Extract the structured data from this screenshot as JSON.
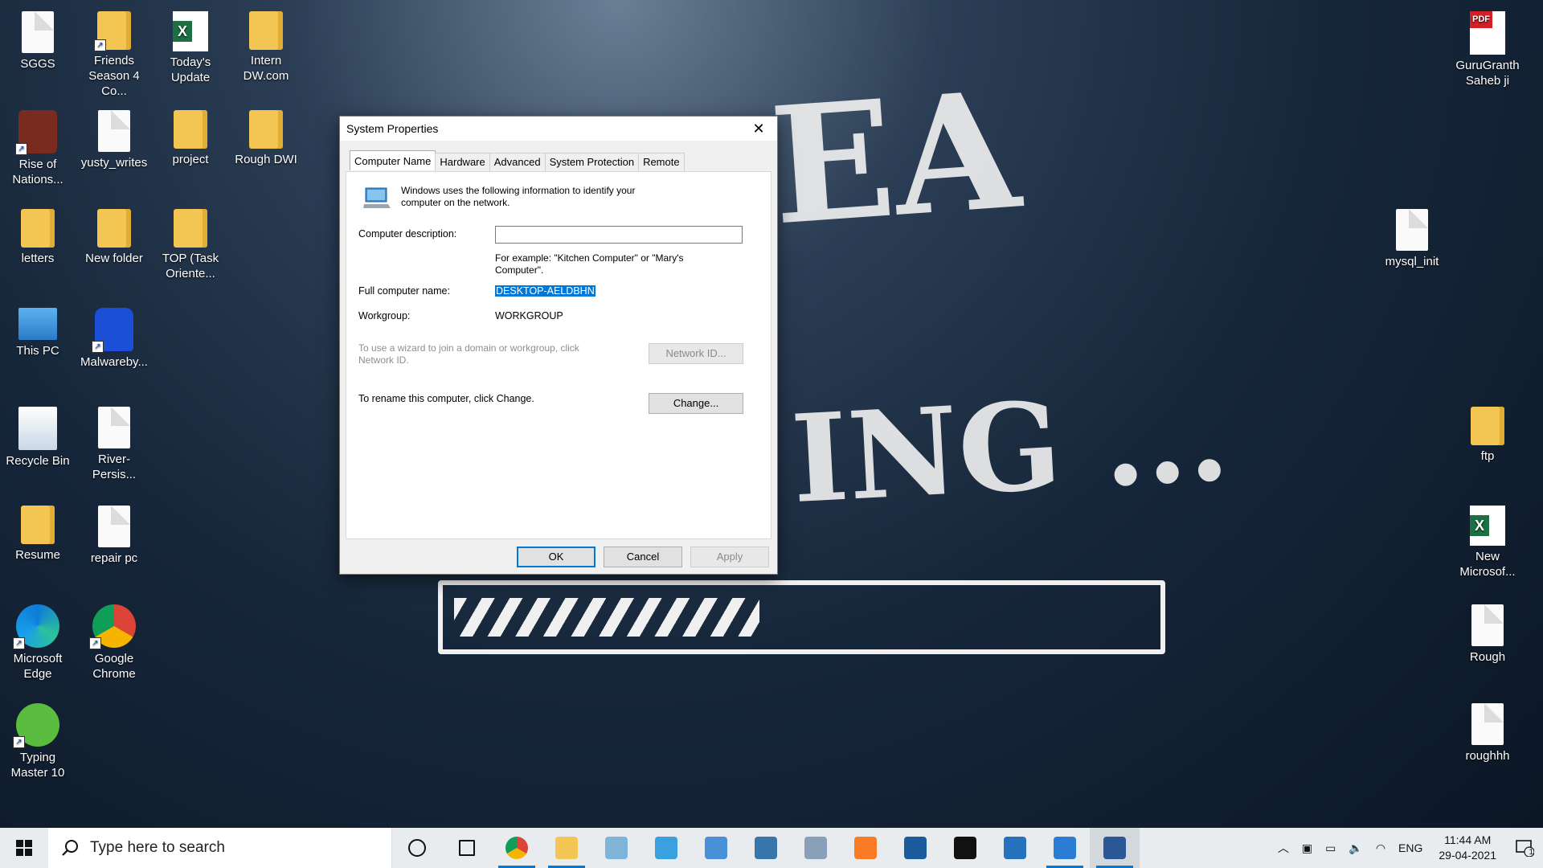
{
  "desktop": {
    "left_icons": [
      {
        "label": "SGGS",
        "type": "doc"
      },
      {
        "label": "Friends Season 4 Co...",
        "type": "folder",
        "shortcut": true
      },
      {
        "label": "Today's Update",
        "type": "excel"
      },
      {
        "label": "Intern DW.com",
        "type": "folder"
      },
      {
        "label": "Rise of Nations...",
        "type": "app-game",
        "shortcut": true
      },
      {
        "label": "yusty_writes",
        "type": "doc"
      },
      {
        "label": "project",
        "type": "folder"
      },
      {
        "label": "Rough DWI",
        "type": "folder"
      },
      {
        "label": "letters",
        "type": "folder"
      },
      {
        "label": "New folder",
        "type": "folder"
      },
      {
        "label": "TOP (Task Oriente...",
        "type": "folder"
      },
      {
        "label": "This PC",
        "type": "this-pc"
      },
      {
        "label": "Malwareby...",
        "type": "malwarebytes",
        "shortcut": true
      },
      {
        "label": "Recycle Bin",
        "type": "recycle-bin"
      },
      {
        "label": "River-Persis...",
        "type": "image"
      },
      {
        "label": "Resume",
        "type": "folder"
      },
      {
        "label": "repair pc",
        "type": "doc"
      },
      {
        "label": "Microsoft Edge",
        "type": "edge",
        "shortcut": true
      },
      {
        "label": "Google Chrome",
        "type": "chrome",
        "shortcut": true
      },
      {
        "label": "Typing Master 10",
        "type": "typing-master",
        "shortcut": true
      }
    ],
    "right_icons": [
      {
        "label": "GuruGranth Saheb ji",
        "type": "pdf"
      },
      {
        "label": "mysql_init",
        "type": "doc"
      },
      {
        "label": "ftp",
        "type": "folder"
      },
      {
        "label": "New Microsof...",
        "type": "excel"
      },
      {
        "label": "Rough",
        "type": "doc"
      },
      {
        "label": "roughhh",
        "type": "doc"
      }
    ],
    "wallpaper_text": {
      "line1": "EA",
      "line2": "ING ..."
    }
  },
  "dialog": {
    "title": "System Properties",
    "tabs": [
      "Computer Name",
      "Hardware",
      "Advanced",
      "System Protection",
      "Remote"
    ],
    "active_tab": "Computer Name",
    "info_text": "Windows uses the following information to identify your computer on the network.",
    "description_label": "Computer description:",
    "description_value": "",
    "example_text": "For example: \"Kitchen Computer\" or \"Mary's Computer\".",
    "full_name_label": "Full computer name:",
    "full_name_value": "DESKTOP-AELDBHN",
    "workgroup_label": "Workgroup:",
    "workgroup_value": "WORKGROUP",
    "network_text": "To use a wizard to join a domain or workgroup, click Network ID.",
    "network_button": "Network ID...",
    "rename_text": "To rename this computer, click Change.",
    "change_button": "Change...",
    "ok_button": "OK",
    "cancel_button": "Cancel",
    "apply_button": "Apply"
  },
  "taskbar": {
    "search_placeholder": "Type here to search",
    "pinned": [
      {
        "name": "cortana-icon",
        "color": "#111111"
      },
      {
        "name": "task-view-icon",
        "color": "#111111"
      },
      {
        "name": "chrome-icon",
        "color": "#db4437",
        "running": true
      },
      {
        "name": "file-explorer-icon",
        "color": "#f3c552",
        "running": true
      },
      {
        "name": "notepad-icon",
        "color": "#7fb4d8"
      },
      {
        "name": "snipping-tool-icon",
        "color": "#3aa0e0"
      },
      {
        "name": "control-panel-icon",
        "color": "#4a90d9"
      },
      {
        "name": "python-icon",
        "color": "#3776ab"
      },
      {
        "name": "performance-monitor-icon",
        "color": "#8aa0b8"
      },
      {
        "name": "xampp-icon",
        "color": "#fb7a24"
      },
      {
        "name": "virtualbox-icon",
        "color": "#1b5d9c"
      },
      {
        "name": "command-prompt-icon",
        "color": "#111111"
      },
      {
        "name": "powershell-icon",
        "color": "#2671be"
      },
      {
        "name": "photos-icon",
        "color": "#2b7cd3",
        "running": true
      },
      {
        "name": "system-properties-icon",
        "color": "#2b5797",
        "running": true,
        "active": true
      }
    ],
    "tray": {
      "language": "ENG",
      "time": "11:44 AM",
      "date": "29-04-2021",
      "notification_count": "1"
    }
  }
}
